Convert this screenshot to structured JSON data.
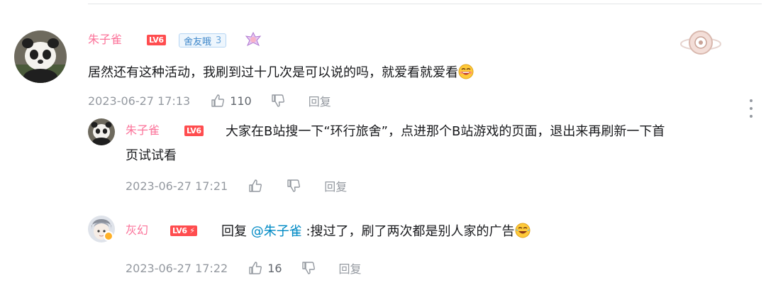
{
  "main_comment": {
    "username": "朱子雀",
    "level": "LV6",
    "fan_medal": {
      "name": "舍友哦",
      "level": "3"
    },
    "content": "居然还有这种活动，我刷到过十几次是可以说的吗，就爱看就爱看",
    "time": "2023-06-27 17:13",
    "likes": "110",
    "reply_label": "回复"
  },
  "replies": [
    {
      "username": "朱子雀",
      "level": "LV6",
      "content_line1": "大家在B站搜一下“环行旅舍”，点进那个B站游戏的页面，退出来再刷新一下首",
      "content_line2": "页试试看",
      "time": "2023-06-27 17:21",
      "likes": "",
      "reply_label": "回复"
    },
    {
      "username": "灰幻",
      "level": "LV6",
      "reply_prefix": "回复",
      "mention": "@朱子雀",
      "content": ":搜过了，刷了两次都是别人家的广告",
      "time": "2023-06-27 17:22",
      "likes": "16",
      "reply_label": "回复"
    }
  ],
  "icons": [
    "like-icon",
    "dislike-icon",
    "more-icon",
    "panda-avatar",
    "anime-avatar",
    "laugh-emoji",
    "tears-of-joy-emoji"
  ],
  "colors": {
    "username": "#fb7299",
    "level_badge": "#ff4d4f",
    "mention": "#008ac5",
    "meta": "#9499a0"
  }
}
